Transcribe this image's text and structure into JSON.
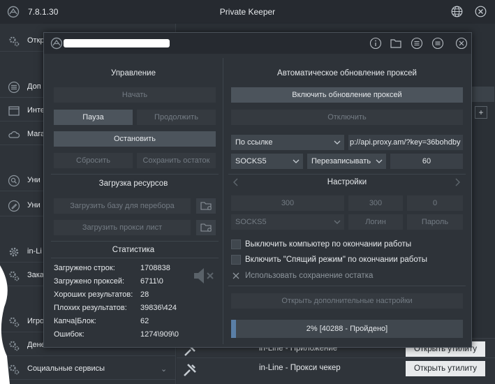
{
  "main": {
    "version": "7.8.1.30",
    "title": "Private Keeper",
    "sidebar_items": [
      {
        "label": "Откр",
        "icon": "gears-icon"
      },
      {
        "label": "Доп",
        "icon": "list-icon"
      },
      {
        "label": "Инте",
        "icon": "window-icon"
      },
      {
        "label": "Мага",
        "icon": "cloud-icon"
      },
      {
        "label": "Уни",
        "icon": "search-icon"
      },
      {
        "label": "Уни",
        "icon": "pen-icon"
      },
      {
        "label": "in-Li",
        "icon": "gear-icon"
      },
      {
        "label": "Зака",
        "icon": "gears-icon"
      },
      {
        "label": "Игро",
        "icon": "gears-icon"
      },
      {
        "label": "Дене",
        "icon": "gears-icon"
      },
      {
        "label": "Социальные сервисы",
        "icon": "gears-icon"
      }
    ],
    "bottom_rows": [
      {
        "label": "in-Line - Приложение",
        "button": "Открыть утилиту"
      },
      {
        "label": "in-Line - Прокси чекер",
        "button": "Открыть утилиту"
      }
    ]
  },
  "dialog": {
    "toolbar_icons": [
      "info-icon",
      "folder-icon",
      "menu-icon",
      "hamburger-icon",
      "close-icon"
    ],
    "control": {
      "heading": "Управление",
      "start": "Начать",
      "pause": "Пауза",
      "continue": "Продолжить",
      "stop": "Остановить",
      "reset": "Сбросить",
      "save_rest": "Сохранить остаток"
    },
    "resources": {
      "heading": "Загрузка ресурсов",
      "load_base": "Загрузить базу для перебора",
      "load_proxy": "Загрузить прокси лист"
    },
    "stats": {
      "heading": "Статистика",
      "rows": [
        {
          "key": "Загружено строк:",
          "value": "1708838"
        },
        {
          "key": "Загружено проксей:",
          "value": "6711\\0"
        },
        {
          "key": "Хороших результатов:",
          "value": "28"
        },
        {
          "key": "Плохих результатов:",
          "value": "39836\\424"
        },
        {
          "key": "Капча|Блок:",
          "value": "62"
        },
        {
          "key": "Ошибок:",
          "value": "1274\\909\\0"
        }
      ]
    },
    "proxy_update": {
      "heading": "Автоматическое обновление проксей",
      "enable": "Включить обновление проксей",
      "disable": "Отключить",
      "source_select": "По ссылке",
      "url": "p://api.proxy.am/?key=36bohdby",
      "type_select": "SOCKS5",
      "mode_select": "Перезаписывать",
      "interval": "60"
    },
    "settings": {
      "heading": "Настройки",
      "threads": "300",
      "timeout": "300",
      "retries": "0",
      "proxy_type": "SOCKS5",
      "login": "Логин",
      "password": "Пароль",
      "check_shutdown": "Выключить компьютер по окончании работы",
      "check_sleep": "Включить \"Спящий режим\" по окончании работы",
      "check_save_rest": "Использовать сохранение остатка",
      "open_more": "Открыть дополнительные настройки"
    },
    "progress": {
      "label": "2% [40288 - Пройдено]",
      "fraction": 0.02
    }
  }
}
